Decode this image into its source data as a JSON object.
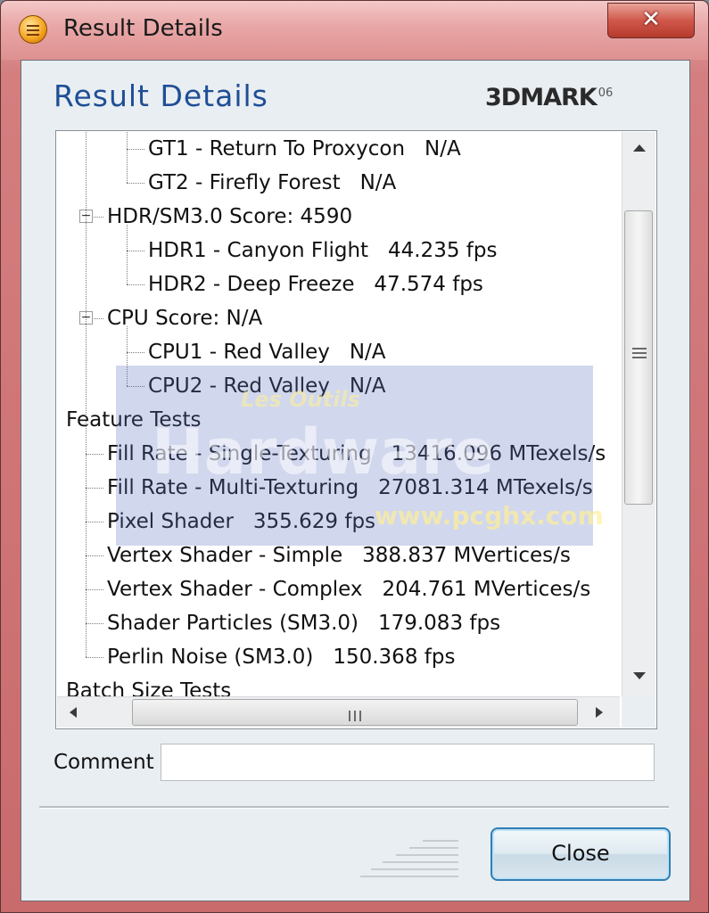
{
  "window": {
    "title": "Result Details",
    "close_glyph": "✕"
  },
  "header": {
    "title": "Result Details",
    "brand": "3DMARK",
    "brand_version": "06"
  },
  "tree": {
    "rows": [
      {
        "indent": 2,
        "text": "GT1 - Return To Proxycon   N/A"
      },
      {
        "indent": 2,
        "text": "GT2 - Firefly Forest   N/A"
      },
      {
        "indent": 1,
        "expander": "−",
        "text": "HDR/SM3.0 Score: 4590"
      },
      {
        "indent": 2,
        "text": "HDR1 - Canyon Flight   44.235 fps"
      },
      {
        "indent": 2,
        "text": "HDR2 - Deep Freeze   47.574 fps"
      },
      {
        "indent": 1,
        "expander": "−",
        "text": "CPU Score: N/A"
      },
      {
        "indent": 2,
        "text": "CPU1 - Red Valley   N/A"
      },
      {
        "indent": 2,
        "text": "CPU2 - Red Valley   N/A"
      },
      {
        "indent": 0,
        "text": "Feature Tests"
      },
      {
        "indent": 1,
        "text": "Fill Rate - Single-Texturing   13416.096 MTexels/s"
      },
      {
        "indent": 1,
        "text": "Fill Rate - Multi-Texturing   27081.314 MTexels/s"
      },
      {
        "indent": 1,
        "text": "Pixel Shader   355.629 fps"
      },
      {
        "indent": 1,
        "text": "Vertex Shader - Simple   388.837 MVertices/s"
      },
      {
        "indent": 1,
        "text": "Vertex Shader - Complex   204.761 MVertices/s"
      },
      {
        "indent": 1,
        "text": "Shader Particles (SM3.0)   179.083 fps"
      },
      {
        "indent": 1,
        "text": "Perlin Noise (SM3.0)   150.368 fps"
      },
      {
        "indent": 0,
        "text": "Batch Size Tests"
      }
    ]
  },
  "comment": {
    "label": "Comment",
    "value": ""
  },
  "buttons": {
    "close": "Close"
  },
  "watermark": {
    "line1": "Les Outils",
    "line2": "Hardware",
    "url": "www.pcghx.com"
  },
  "colors": {
    "accent": "#1f4e96",
    "titlebar": "#e9a8a8",
    "close_button_border": "#2f7fb4"
  },
  "icons": {
    "app": "app-menu-icon",
    "close": "close-icon"
  }
}
